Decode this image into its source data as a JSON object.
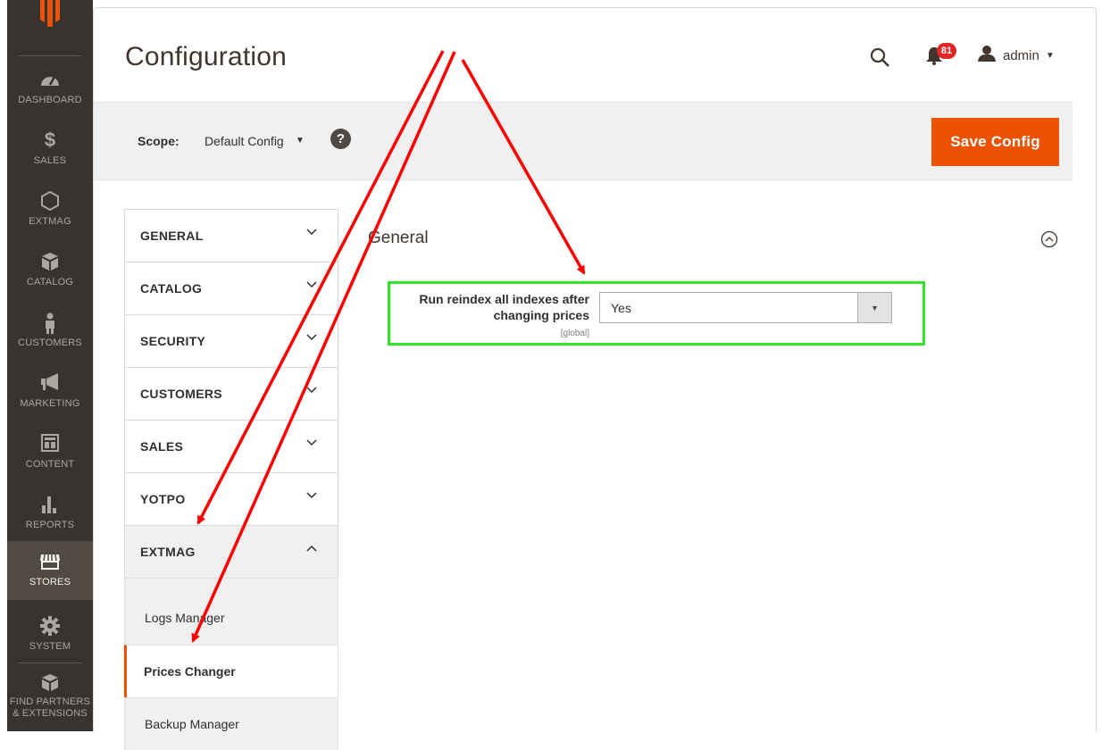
{
  "nav": {
    "items": [
      {
        "label": "DASHBOARD",
        "icon": "dashboard-icon"
      },
      {
        "label": "SALES",
        "icon": "dollar-icon"
      },
      {
        "label": "EXTMAG",
        "icon": "hexagon-icon"
      },
      {
        "label": "CATALOG",
        "icon": "box-icon"
      },
      {
        "label": "CUSTOMERS",
        "icon": "person-icon"
      },
      {
        "label": "MARKETING",
        "icon": "megaphone-icon"
      },
      {
        "label": "CONTENT",
        "icon": "layout-icon"
      },
      {
        "label": "REPORTS",
        "icon": "bar-chart-icon"
      },
      {
        "label": "STORES",
        "icon": "store-icon"
      },
      {
        "label": "SYSTEM",
        "icon": "gear-icon"
      },
      {
        "label_line1": "FIND PARTNERS",
        "label_line2": "& EXTENSIONS",
        "icon": "cubes-icon"
      }
    ],
    "active": "STORES"
  },
  "header": {
    "title": "Configuration",
    "notifications_count": "81",
    "user": "admin"
  },
  "scope": {
    "label": "Scope:",
    "value": "Default Config",
    "help": "?",
    "save_label": "Save Config"
  },
  "tabs": [
    {
      "label": "GENERAL"
    },
    {
      "label": "CATALOG"
    },
    {
      "label": "SECURITY"
    },
    {
      "label": "CUSTOMERS"
    },
    {
      "label": "SALES"
    },
    {
      "label": "YOTPO"
    },
    {
      "label": "EXTMAG"
    }
  ],
  "subitems": [
    {
      "label": "Logs Manager"
    },
    {
      "label": "Prices Changer"
    },
    {
      "label": "Backup Manager"
    }
  ],
  "section": {
    "title": "General",
    "field_label_line1": "Run reindex all indexes after",
    "field_label_line2": "changing prices",
    "field_scope": "[global]",
    "field_value": "Yes"
  },
  "colors": {
    "accent": "#eb5202",
    "nav_bg": "#373330",
    "highlight_box": "#33e22a",
    "arrow": "#ff0000",
    "badge": "#e22626"
  }
}
